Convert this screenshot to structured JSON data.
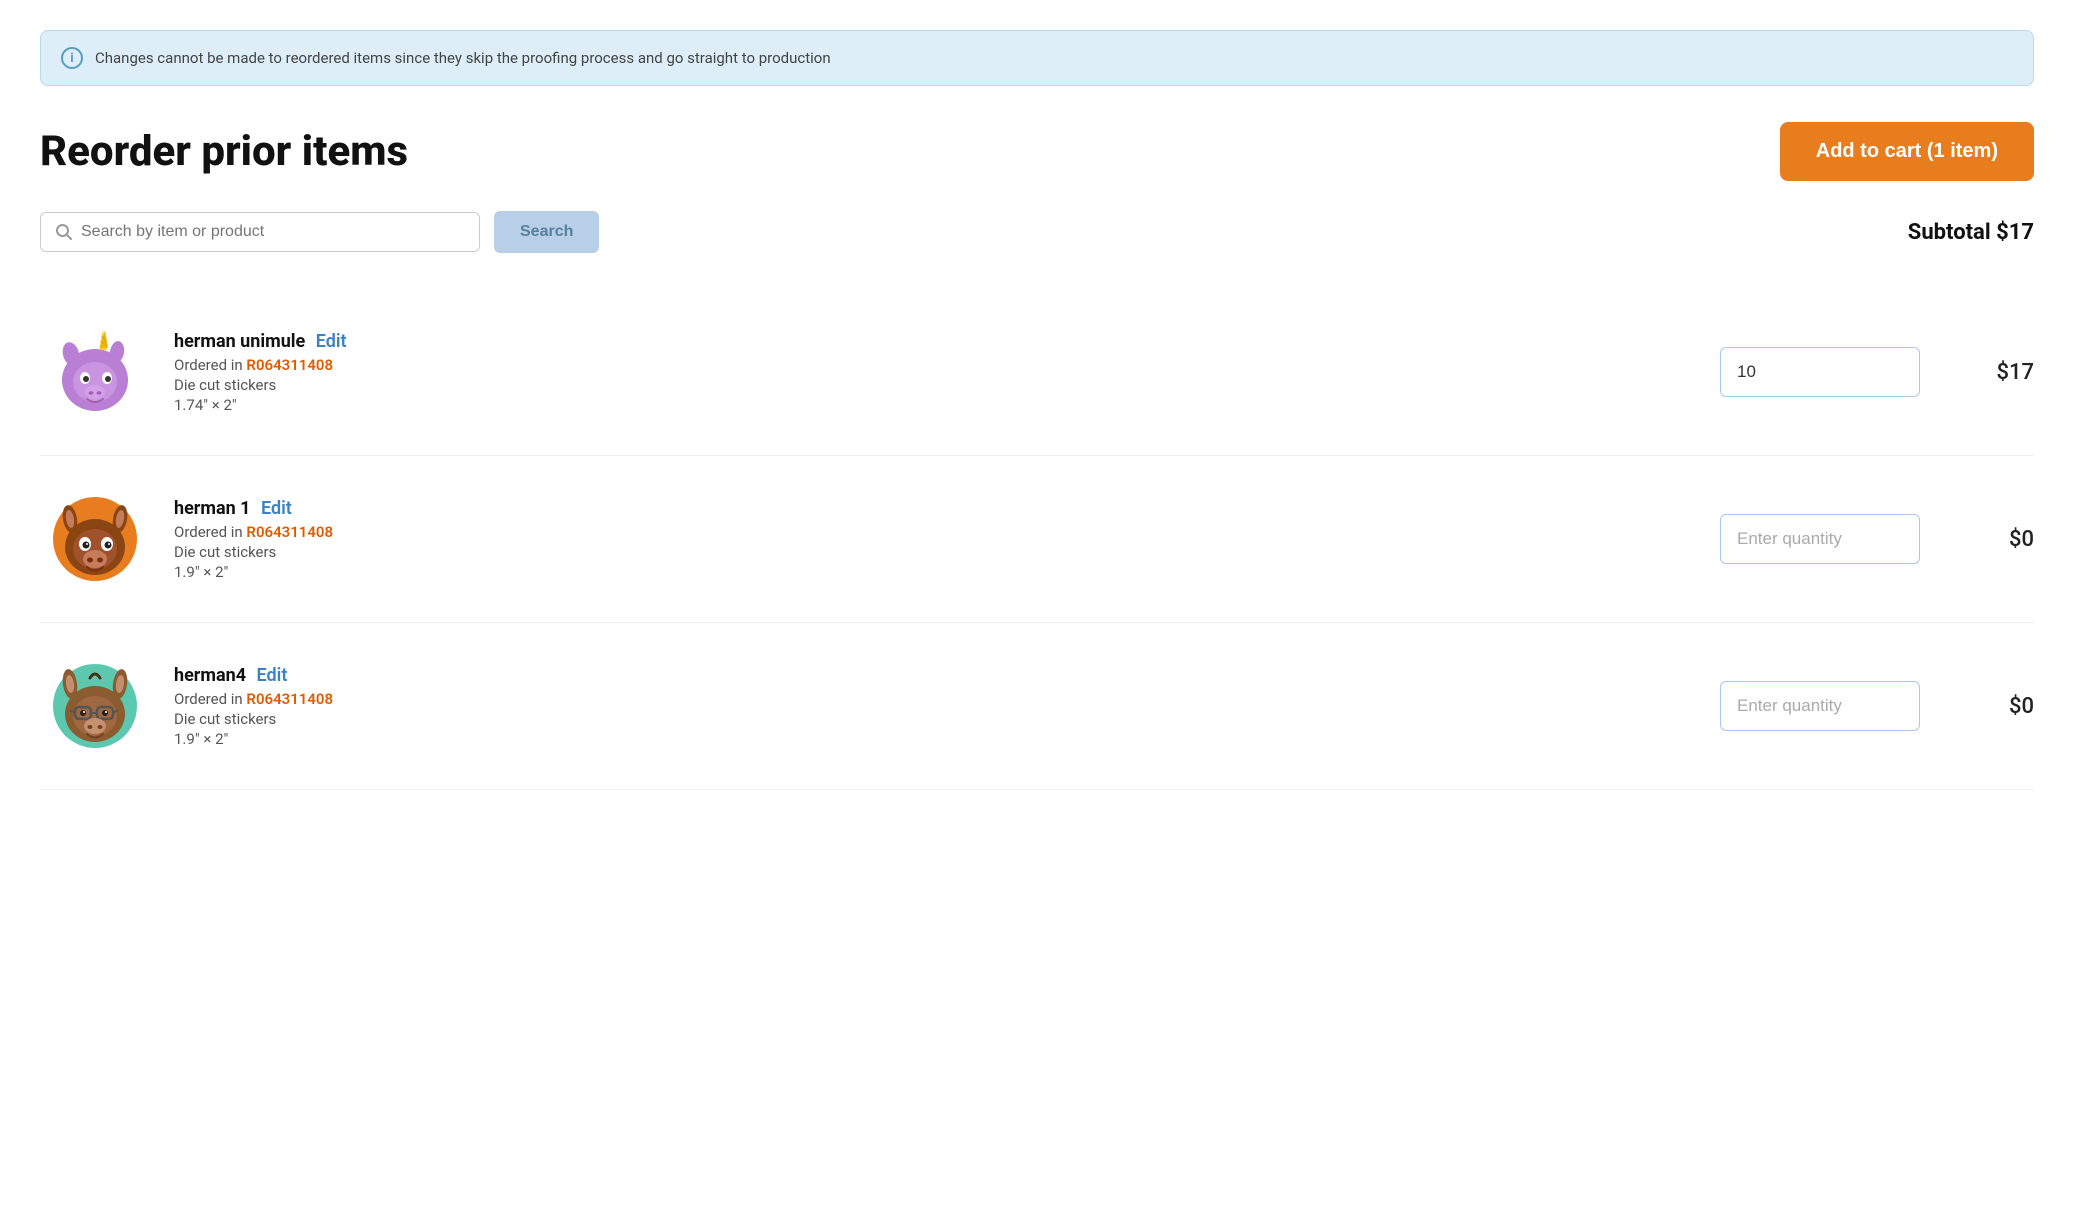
{
  "banner": {
    "text": "Changes cannot be made to reordered items since they skip the proofing process and go straight to production"
  },
  "header": {
    "title": "Reorder prior items",
    "add_to_cart_label": "Add to cart (1 item)"
  },
  "search": {
    "placeholder": "Search by item or product",
    "button_label": "Search",
    "subtotal_label": "Subtotal $17"
  },
  "items": [
    {
      "id": "1",
      "name": "herman unimule",
      "edit_label": "Edit",
      "order_prefix": "Ordered in",
      "order_id": "R064311408",
      "type": "Die cut stickers",
      "size": "1.74″ × 2″",
      "quantity_value": "10",
      "quantity_placeholder": "",
      "price": "$17",
      "sticker_type": "unimule"
    },
    {
      "id": "2",
      "name": "herman 1",
      "edit_label": "Edit",
      "order_prefix": "Ordered in",
      "order_id": "R064311408",
      "type": "Die cut stickers",
      "size": "1.9″ × 2″",
      "quantity_value": "",
      "quantity_placeholder": "Enter quantity",
      "price": "$0",
      "sticker_type": "herman1"
    },
    {
      "id": "3",
      "name": "herman4",
      "edit_label": "Edit",
      "order_prefix": "Ordered in",
      "order_id": "R064311408",
      "type": "Die cut stickers",
      "size": "1.9″ × 2″",
      "quantity_value": "",
      "quantity_placeholder": "Enter quantity",
      "price": "$0",
      "sticker_type": "herman4"
    }
  ]
}
